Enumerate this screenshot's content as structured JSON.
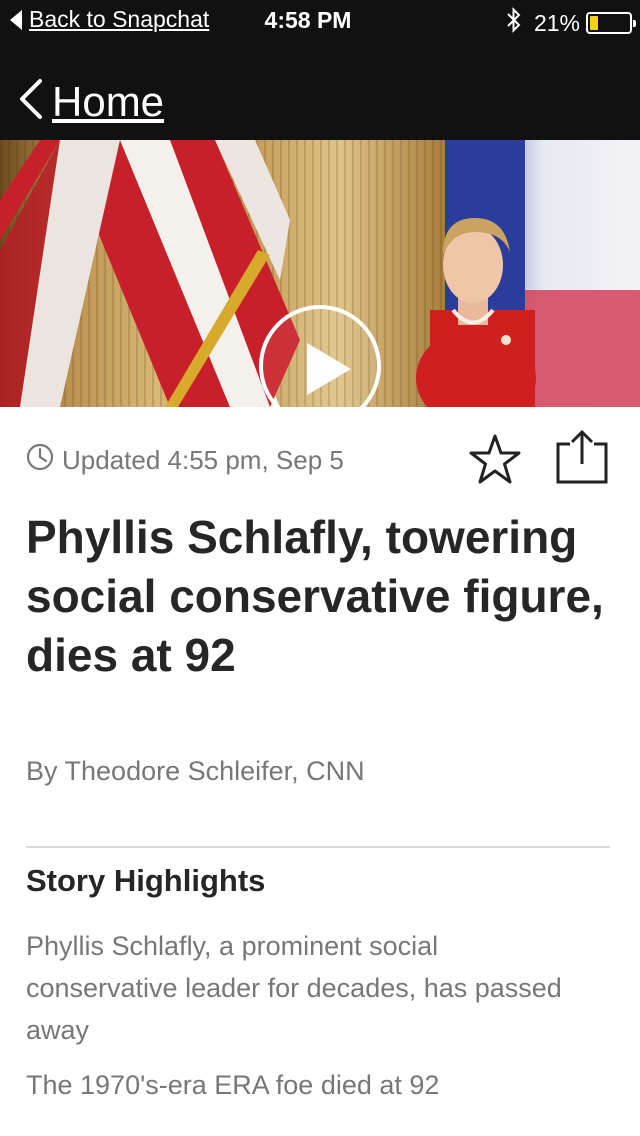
{
  "status_bar": {
    "back_label": "Back to Snapchat",
    "time": "4:58 PM",
    "battery_percent": "21%",
    "battery_level": 0.21,
    "battery_color": "#f5d21a"
  },
  "nav": {
    "back_label": "Home"
  },
  "article": {
    "updated": "Updated 4:55 pm, Sep 5",
    "headline": "Phyllis Schlafly, towering social conservative figure, dies at 92",
    "byline": "By Theodore Schleifer, CNN"
  },
  "highlights": {
    "title": "Story Highlights",
    "items": [
      "Phyllis Schlafly, a prominent social conservative leader for decades, has passed away",
      "The 1970's-era ERA foe died at 92"
    ]
  },
  "icons": {
    "back": "chevron-left-icon",
    "clock": "clock-icon",
    "favorite": "star-icon",
    "share": "share-icon",
    "play": "play-icon",
    "bluetooth": "bluetooth-icon"
  }
}
